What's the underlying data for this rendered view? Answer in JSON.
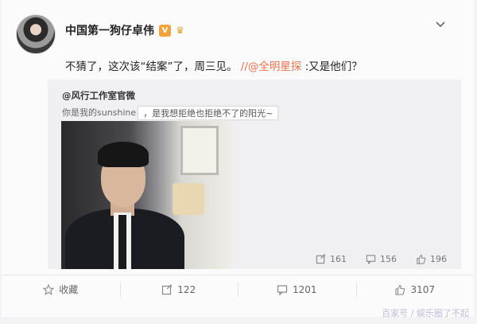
{
  "post": {
    "author_name": "中国第一狗仔卓伟",
    "badge_text": "V",
    "text_prefix": "不猜了，这次该“结案”了，周三见。",
    "mention": "//@全明星探",
    "text_suffix": ":又是他们？"
  },
  "repost": {
    "author": "@风行工作室官微",
    "text_part1": "你是我的sunshine",
    "text_sticker": "，是我想拒绝也拒绝不了的阳光~",
    "stats": {
      "forward_count": "161",
      "comment_count": "156",
      "like_count": "196"
    }
  },
  "actions": {
    "favorite_label": "收藏",
    "forward_count": "122",
    "comment_count": "1201",
    "like_count": "3107"
  },
  "watermark": "百家号 / 娱乐圈了不起",
  "colors": {
    "mention": "#eb7350",
    "badge": "#f3a23a",
    "background": "#fbfbfc",
    "repost_bg": "#f0eff2"
  }
}
